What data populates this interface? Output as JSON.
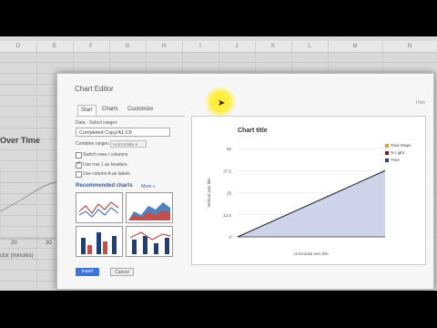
{
  "sheet": {
    "columns": [
      "D",
      "E",
      "F",
      "G",
      "H",
      "I",
      "J",
      "K",
      "L",
      "M",
      "N"
    ],
    "bg_chart_title": "Over Time",
    "bg_ticks": [
      "20",
      "30"
    ],
    "bg_xlabel": "ctor (minutes)"
  },
  "dialog": {
    "title": "Chart Editor",
    "close": "Hide",
    "tabs": [
      "Start",
      "Charts",
      "Customize"
    ],
    "data_range_label": "Data - Select ranges",
    "data_range_value": "Completed Copy!A1:C8",
    "combine_label": "Combine ranges",
    "combine_value": "Horizontally",
    "switch_label": "Switch rows / columns",
    "row1_label": "Use row 1 as headers",
    "colA_label": "Use column A as labels",
    "recommended": "Recommended charts",
    "more": "More »",
    "insert": "Insert",
    "cancel": "Cancel"
  },
  "preview": {
    "title": "Chart title",
    "ylabel": "Vertical axis title",
    "xlabel": "Horizontal axis title"
  },
  "chart_data": {
    "type": "area",
    "title": "Chart title",
    "ylabel": "Vertical axis title",
    "xlabel": "Horizontal axis title",
    "y_ticks": [
      "0",
      "12.5",
      "25",
      "37.5",
      "50"
    ],
    "ylim": [
      0,
      50
    ],
    "x": [
      0,
      1
    ],
    "series": [
      {
        "name": "Time Elaps",
        "values": [
          0,
          37.5
        ],
        "color": "#4a6fb0"
      },
      {
        "name": "% Light",
        "values": [
          0,
          0
        ],
        "color": "#c0504d"
      },
      {
        "name": "Time",
        "values": [
          0,
          0
        ],
        "color": "#1f3f7a"
      }
    ],
    "fill_color": "#c8cfe8",
    "line_color": "#1a1a1a",
    "grid": true,
    "legend": "right"
  },
  "colors": {
    "accent": "#3e74d6",
    "link": "#3d5a9c",
    "cursor_highlight": "#ffee28"
  }
}
